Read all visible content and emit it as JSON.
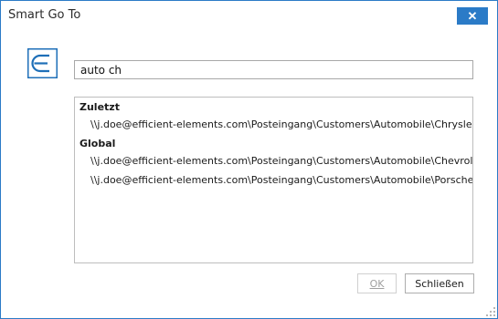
{
  "window": {
    "title": "Smart Go To",
    "close_label": "✕"
  },
  "search": {
    "value": "auto ch"
  },
  "results": {
    "groups": [
      {
        "header": "Zuletzt",
        "items": [
          "\\\\j.doe@efficient-elements.com\\Posteingang\\Customers\\Automobile\\Chrysler"
        ]
      },
      {
        "header": "Global",
        "items": [
          "\\\\j.doe@efficient-elements.com\\Posteingang\\Customers\\Automobile\\Chevrolet",
          "\\\\j.doe@efficient-elements.com\\Posteingang\\Customers\\Automobile\\Porsche"
        ]
      }
    ]
  },
  "buttons": {
    "ok_label": "OK",
    "close_label": "Schließen"
  },
  "colors": {
    "accent": "#2b7bc7",
    "logo": "#1e6fb8"
  },
  "icons": {
    "logo": "efficient-elements-logo-icon",
    "close": "close-icon",
    "grip": "resize-grip-icon"
  }
}
